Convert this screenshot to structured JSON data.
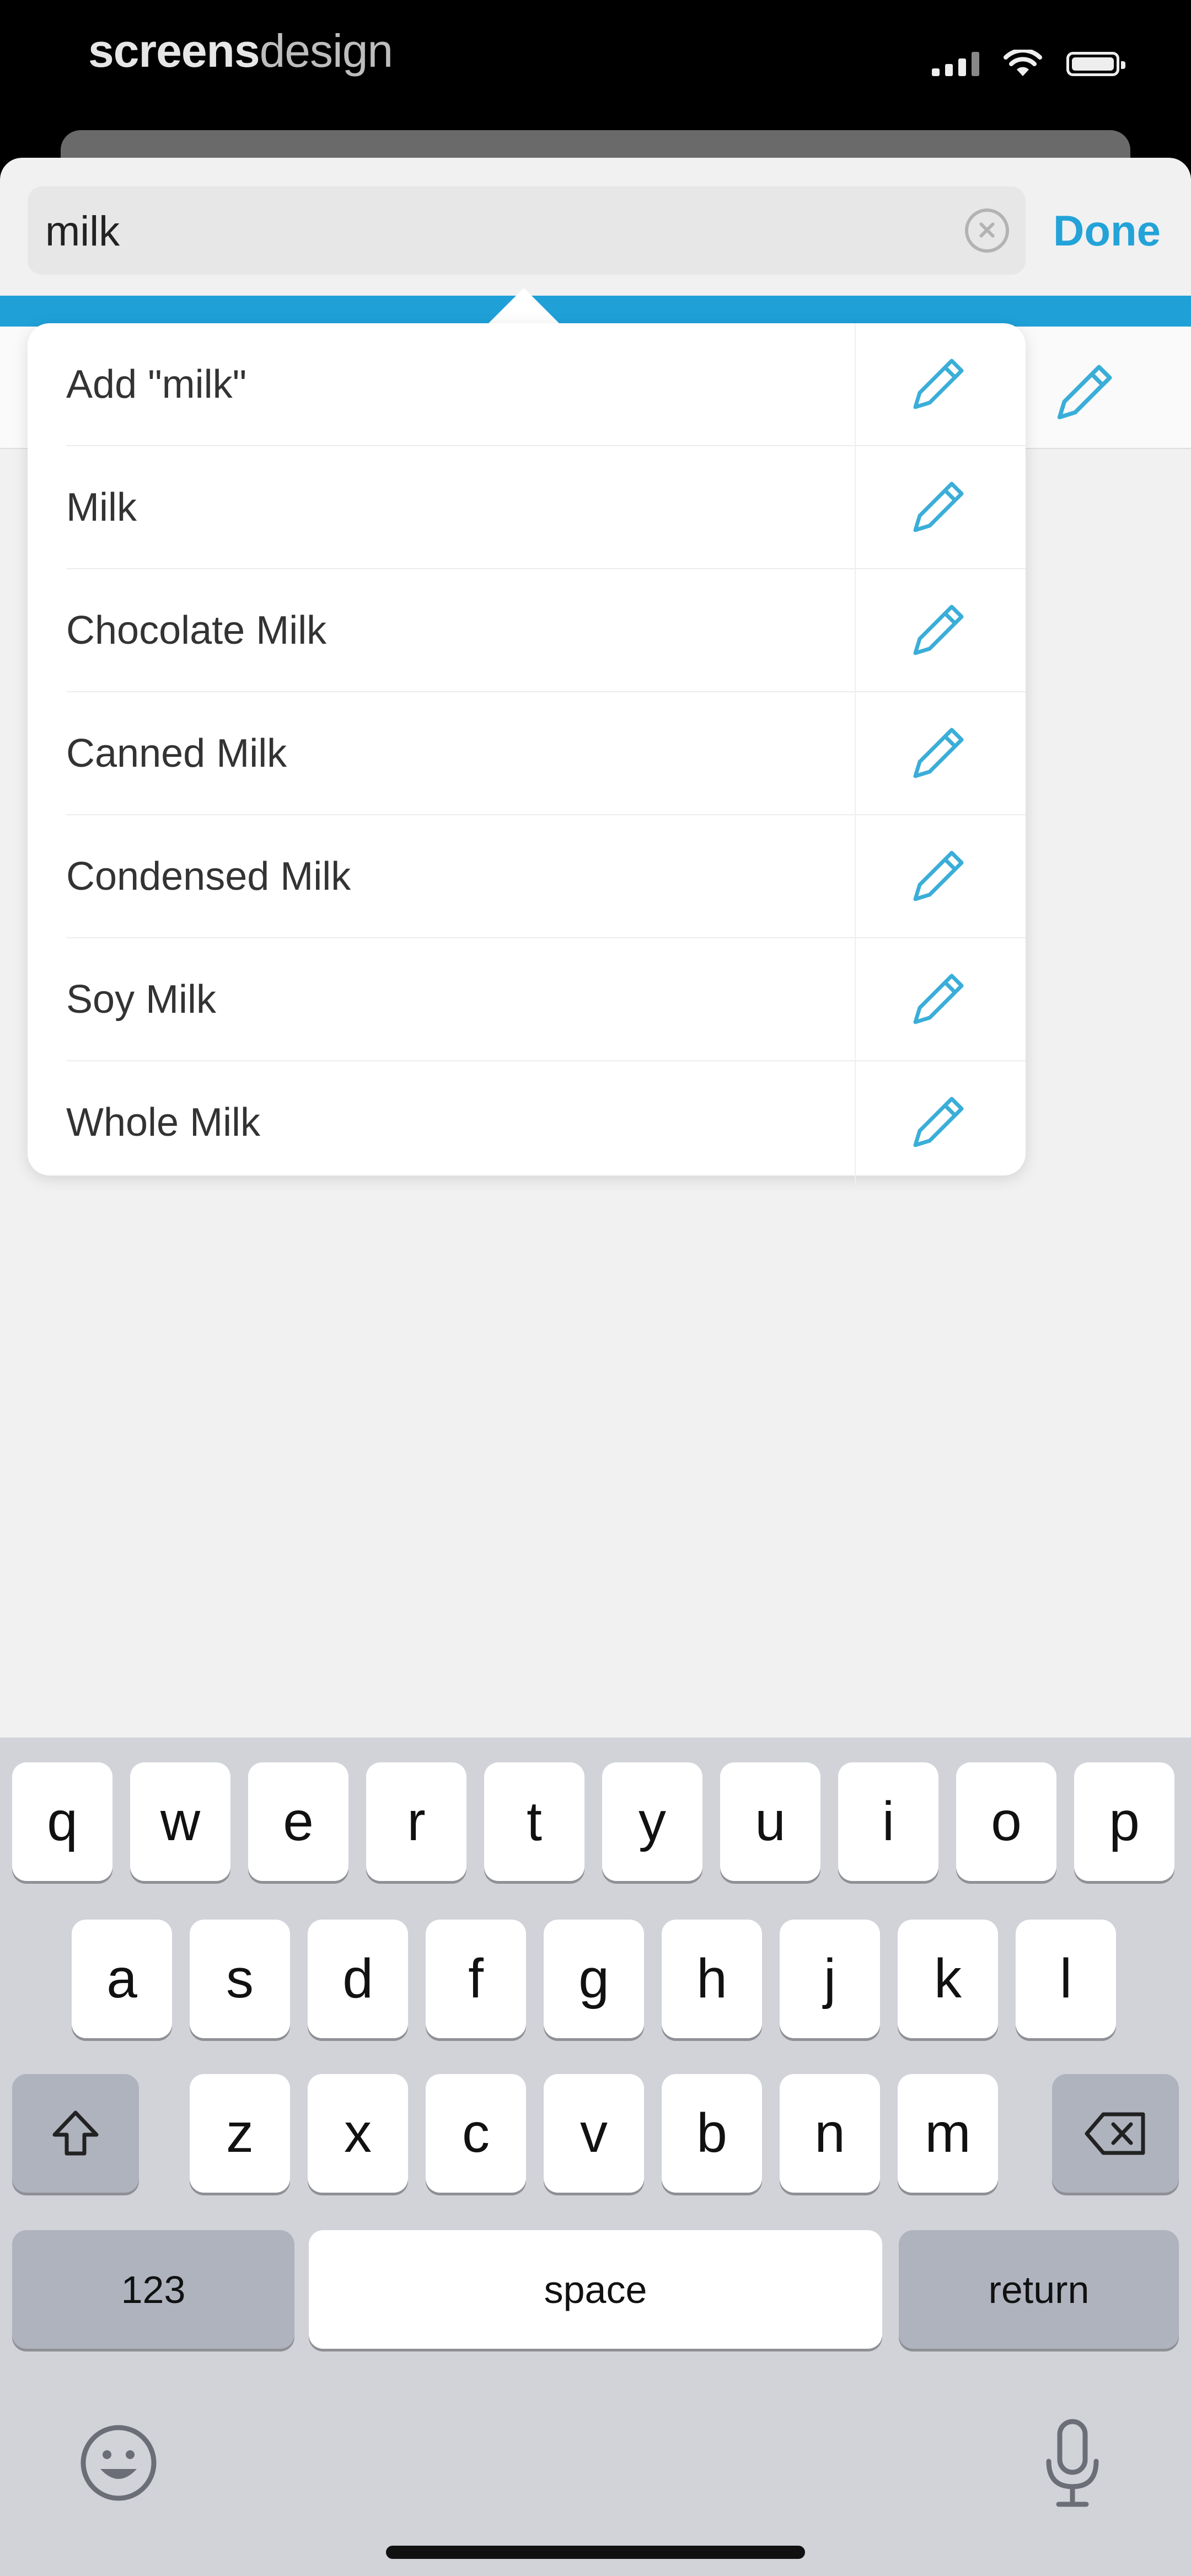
{
  "status_bar": {
    "brand_bold": "screens",
    "brand_light": "design"
  },
  "search": {
    "value": "milk",
    "done_label": "Done"
  },
  "suggestions": [
    {
      "label": "Add \"milk\""
    },
    {
      "label": "Milk"
    },
    {
      "label": "Chocolate Milk"
    },
    {
      "label": "Canned Milk"
    },
    {
      "label": "Condensed Milk"
    },
    {
      "label": "Soy Milk"
    },
    {
      "label": "Whole Milk"
    }
  ],
  "keyboard": {
    "row1": [
      "q",
      "w",
      "e",
      "r",
      "t",
      "y",
      "u",
      "i",
      "o",
      "p"
    ],
    "row2": [
      "a",
      "s",
      "d",
      "f",
      "g",
      "h",
      "j",
      "k",
      "l"
    ],
    "row3": [
      "z",
      "x",
      "c",
      "v",
      "b",
      "n",
      "m"
    ],
    "numbers_label": "123",
    "space_label": "space",
    "return_label": "return"
  },
  "colors": {
    "accent": "#1fa1d8",
    "pencil": "#3aaed8"
  },
  "icons": {
    "edit": "pencil-icon",
    "clear": "clear-circle-icon",
    "shift": "shift-arrow-icon",
    "delete": "backspace-icon",
    "emoji": "emoji-face-icon",
    "mic": "microphone-icon"
  }
}
